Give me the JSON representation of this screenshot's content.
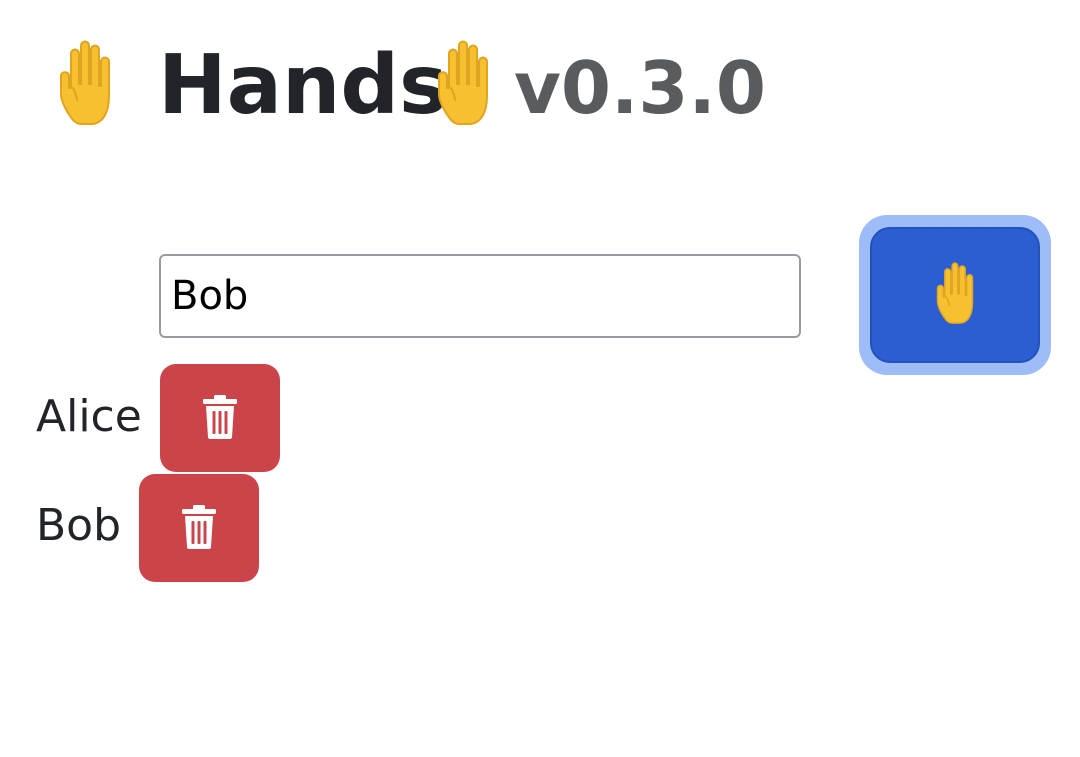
{
  "header": {
    "title": "Hands",
    "version": "v0.3.0",
    "title_emoji": "raised-hand-icon"
  },
  "form": {
    "name_value": "Bob",
    "raise_button_icon": "raised-hand-icon"
  },
  "people": [
    {
      "name": "Alice",
      "delete_icon": "trash-icon"
    },
    {
      "name": "Bob",
      "delete_icon": "trash-icon"
    }
  ],
  "colors": {
    "raise_button": "#2a5ed1",
    "raise_button_focus_ring": "#9ebcf7",
    "delete_button": "#cb444a",
    "title_text": "#212529",
    "version_text": "#595c5f",
    "emoji_yellow": "#f6c030"
  }
}
